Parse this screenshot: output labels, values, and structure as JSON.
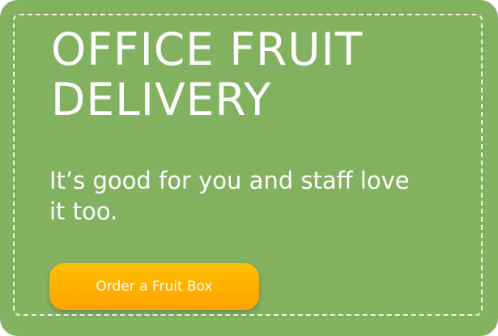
{
  "banner": {
    "title_line1": "OFFICE FRUIT",
    "title_line2": "DELIVERY",
    "subtitle": "It’s good for you and staff love it too.",
    "cta_label": "Order a Fruit Box"
  },
  "colors": {
    "background": "#82b160",
    "button": "#ffb000",
    "dash": "#f1efe2"
  }
}
